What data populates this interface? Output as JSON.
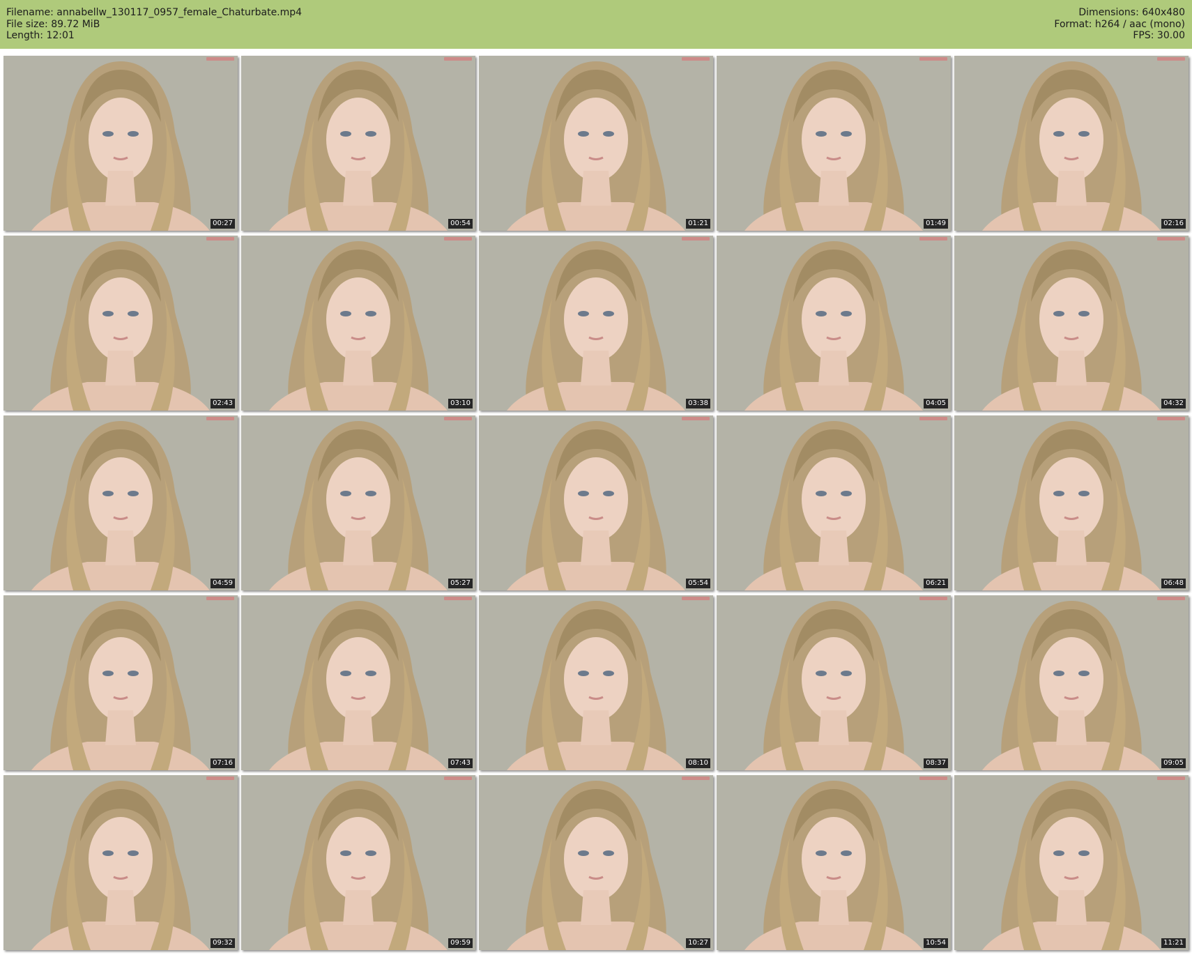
{
  "header": {
    "filename": "Filename: annabellw_130117_0957_female_Chaturbate.mp4",
    "filesize": "File size: 89.72 MiB",
    "length": "Length: 12:01",
    "dimensions": "Dimensions: 640x480",
    "format": "Format: h264 / aac (mono)",
    "fps": "FPS: 30.00"
  },
  "colors": {
    "header_bg": "#afca7b",
    "frame_bg": "#b3b2a6",
    "timestamp_bg": "#262626"
  },
  "thumbnails": [
    {
      "time": "00:27"
    },
    {
      "time": "00:54"
    },
    {
      "time": "01:21"
    },
    {
      "time": "01:49"
    },
    {
      "time": "02:16"
    },
    {
      "time": "02:43"
    },
    {
      "time": "03:10"
    },
    {
      "time": "03:38"
    },
    {
      "time": "04:05"
    },
    {
      "time": "04:32"
    },
    {
      "time": "04:59"
    },
    {
      "time": "05:27"
    },
    {
      "time": "05:54"
    },
    {
      "time": "06:21"
    },
    {
      "time": "06:48"
    },
    {
      "time": "07:16"
    },
    {
      "time": "07:43"
    },
    {
      "time": "08:10"
    },
    {
      "time": "08:37"
    },
    {
      "time": "09:05"
    },
    {
      "time": "09:32"
    },
    {
      "time": "09:59"
    },
    {
      "time": "10:27"
    },
    {
      "time": "10:54"
    },
    {
      "time": "11:21"
    }
  ]
}
